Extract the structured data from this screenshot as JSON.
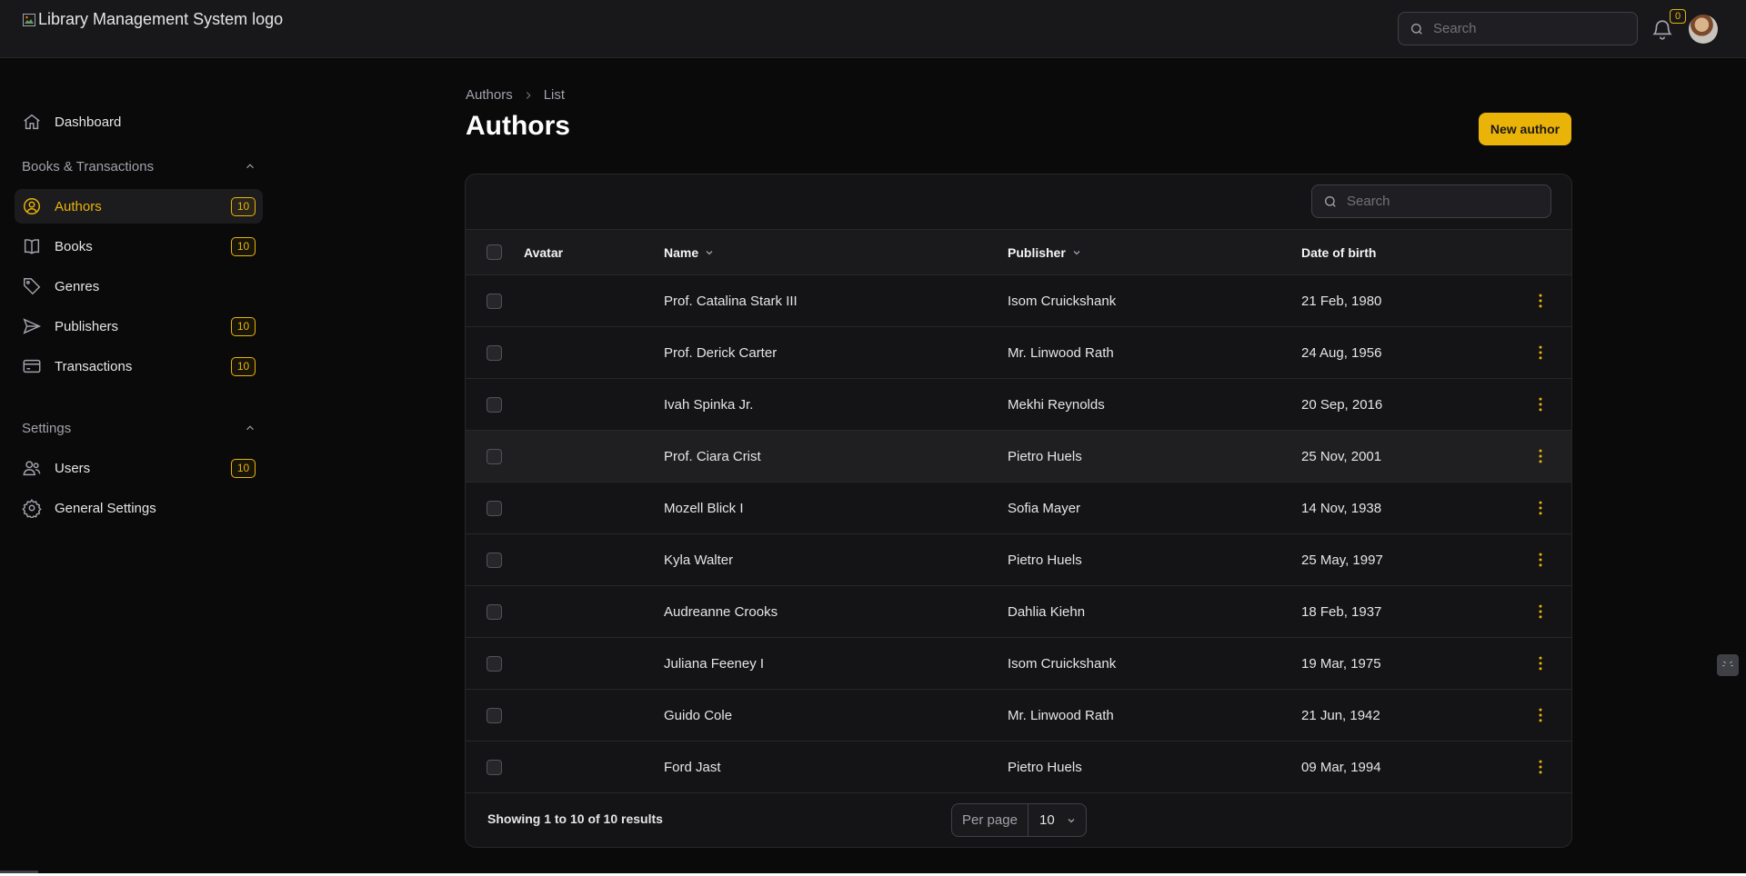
{
  "header": {
    "logo_alt": "Library Management System logo",
    "search_placeholder": "Search",
    "notification_count": "0"
  },
  "sidebar": {
    "dashboard": "Dashboard",
    "groups": [
      {
        "label": "Books & Transactions",
        "items": [
          {
            "label": "Authors",
            "badge": "10",
            "icon": "user-circle-icon",
            "active": true
          },
          {
            "label": "Books",
            "badge": "10",
            "icon": "book-icon"
          },
          {
            "label": "Genres",
            "badge": "",
            "icon": "tag-icon"
          },
          {
            "label": "Publishers",
            "badge": "10",
            "icon": "paper-plane-icon"
          },
          {
            "label": "Transactions",
            "badge": "10",
            "icon": "credit-card-icon"
          }
        ]
      },
      {
        "label": "Settings",
        "items": [
          {
            "label": "Users",
            "badge": "10",
            "icon": "users-icon"
          },
          {
            "label": "General Settings",
            "badge": "",
            "icon": "gear-icon"
          }
        ]
      }
    ]
  },
  "breadcrumb": [
    "Authors",
    "List"
  ],
  "page": {
    "title": "Authors",
    "new_button": "New author"
  },
  "table": {
    "search_placeholder": "Search",
    "columns": [
      "Avatar",
      "Name",
      "Publisher",
      "Date of birth"
    ],
    "rows": [
      {
        "name": "Prof. Catalina Stark III",
        "publisher": "Isom Cruickshank",
        "dob": "21 Feb, 1980"
      },
      {
        "name": "Prof. Derick Carter",
        "publisher": "Mr. Linwood Rath",
        "dob": "24 Aug, 1956"
      },
      {
        "name": "Ivah Spinka Jr.",
        "publisher": "Mekhi Reynolds",
        "dob": "20 Sep, 2016"
      },
      {
        "name": "Prof. Ciara Crist",
        "publisher": "Pietro Huels",
        "dob": "25 Nov, 2001"
      },
      {
        "name": "Mozell Blick I",
        "publisher": "Sofia Mayer",
        "dob": "14 Nov, 1938"
      },
      {
        "name": "Kyla Walter",
        "publisher": "Pietro Huels",
        "dob": "25 May, 1997"
      },
      {
        "name": "Audreanne Crooks",
        "publisher": "Dahlia Kiehn",
        "dob": "18 Feb, 1937"
      },
      {
        "name": "Juliana Feeney I",
        "publisher": "Isom Cruickshank",
        "dob": "19 Mar, 1975"
      },
      {
        "name": "Guido Cole",
        "publisher": "Mr. Linwood Rath",
        "dob": "21 Jun, 1942"
      },
      {
        "name": "Ford Jast",
        "publisher": "Pietro Huels",
        "dob": "09 Mar, 1994"
      }
    ],
    "footer": {
      "results": "Showing 1 to 10 of 10 results",
      "per_page_label": "Per page",
      "per_page_value": "10"
    }
  },
  "colors": {
    "accent": "#eab308",
    "background": "#0a0a0b",
    "surface": "#141416"
  }
}
